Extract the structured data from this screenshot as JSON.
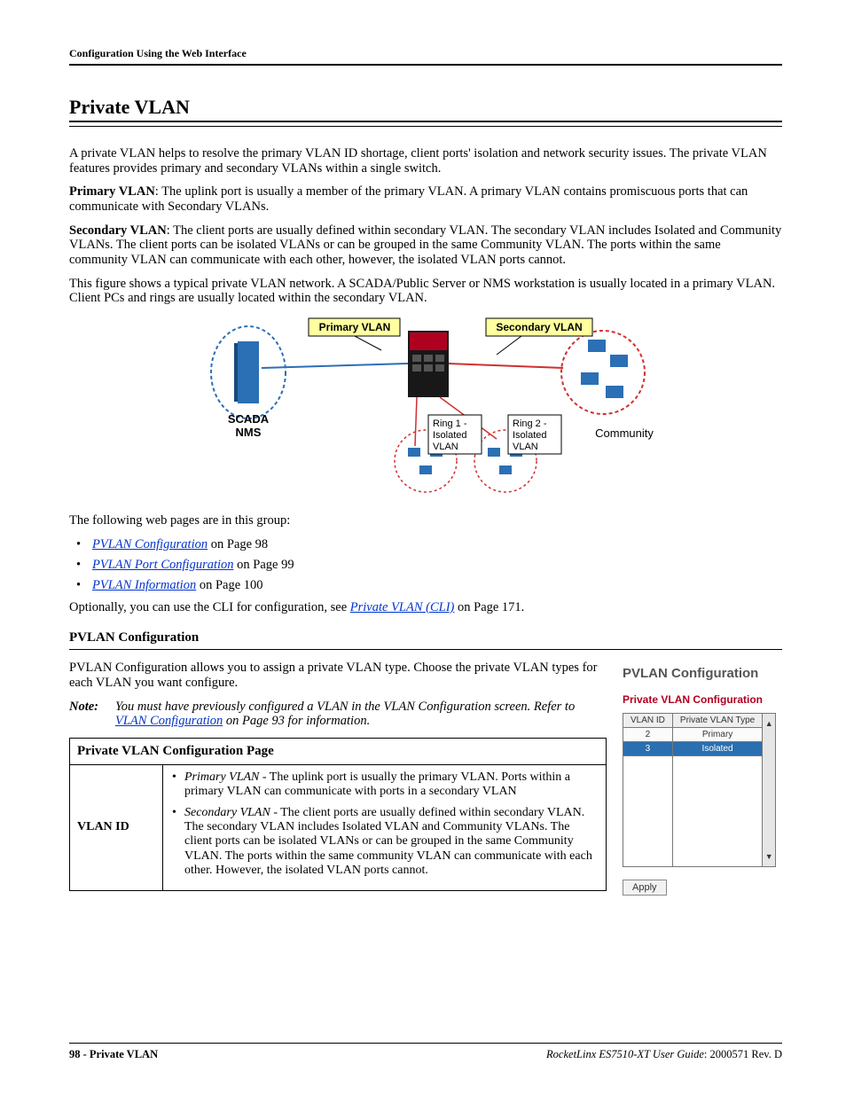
{
  "header": {
    "title": "Configuration Using the Web Interface"
  },
  "section": {
    "title": "Private VLAN"
  },
  "body": {
    "p1": "A private VLAN helps to resolve the primary VLAN ID shortage, client ports' isolation and network security issues. The private VLAN features provides primary and secondary VLANs within a single switch.",
    "p2_bold": "Primary VLAN",
    "p2_rest": ": The uplink port is usually a member of the primary VLAN. A primary VLAN contains promiscuous ports that can communicate with Secondary VLANs.",
    "p3_bold": "Secondary VLAN",
    "p3_rest": ": The client ports are usually defined within secondary VLAN. The secondary VLAN includes Isolated and Community VLANs. The client ports can be isolated VLANs or can be grouped in the same Community VLAN. The ports within the same community VLAN can communicate with each other, however, the isolated VLAN ports cannot.",
    "p4": "This figure shows a typical private VLAN network. A SCADA/Public Server or NMS workstation is usually located in a primary VLAN. Client PCs and rings are usually located within the secondary VLAN.",
    "p5": "The following web pages are in this group:",
    "list": [
      {
        "link": "PVLAN Configuration",
        "suffix": " on Page 98"
      },
      {
        "link": "PVLAN Port Configuration",
        "suffix": " on Page 99"
      },
      {
        "link": "PVLAN Information",
        "suffix": " on Page 100"
      }
    ],
    "p6_prefix": "Optionally, you can use the CLI for configuration, see ",
    "p6_link": "Private VLAN (CLI)",
    "p6_suffix": " on Page 171."
  },
  "subsection": {
    "title": "PVLAN Configuration",
    "p1": "PVLAN Configuration allows you to assign a private VLAN type. Choose the private VLAN types for each VLAN you want configure.",
    "note_label": "Note:",
    "note_prefix": "You must have previously configured a VLAN in the VLAN Configuration screen. Refer to ",
    "note_link": "VLAN Configuration",
    "note_suffix": " on Page 93 for information.",
    "table_header": "Private VLAN Configuration Page",
    "row_label": "VLAN ID",
    "bullet1_emph": "Primary VLAN",
    "bullet1_rest": " - The uplink port is usually the primary VLAN. Ports within a primary VLAN can communicate with ports in a secondary VLAN",
    "bullet2_emph": "Secondary VLAN",
    "bullet2_rest": " - The client ports are usually defined within secondary VLAN. The secondary VLAN includes Isolated VLAN and Community VLANs. The client ports can be isolated VLANs or can be grouped in the same Community VLAN. The ports within the same community VLAN can communicate with each other. However, the isolated VLAN ports cannot."
  },
  "panel": {
    "title": "PVLAN Configuration",
    "subtitle": "Private VLAN Configuration",
    "col1": "VLAN ID",
    "col2": "Private VLAN Type",
    "rows": [
      {
        "id": "2",
        "type": "Primary",
        "selected": false
      },
      {
        "id": "3",
        "type": "Isolated",
        "selected": true
      }
    ],
    "apply": "Apply"
  },
  "diagram": {
    "primary": "Primary VLAN",
    "secondary": "Secondary VLAN",
    "scada": "SCADA",
    "nms": "NMS",
    "ring1a": "Ring 1 -",
    "ring1b": "Isolated",
    "ring1c": "VLAN",
    "ring2a": "Ring 2 -",
    "ring2b": "Isolated",
    "ring2c": "VLAN",
    "community": "Community"
  },
  "footer": {
    "left_page": "98 - Private VLAN",
    "right_product": "RocketLinx ES7510-XT  User Guide",
    "right_doc": ": 2000571 Rev. D"
  }
}
